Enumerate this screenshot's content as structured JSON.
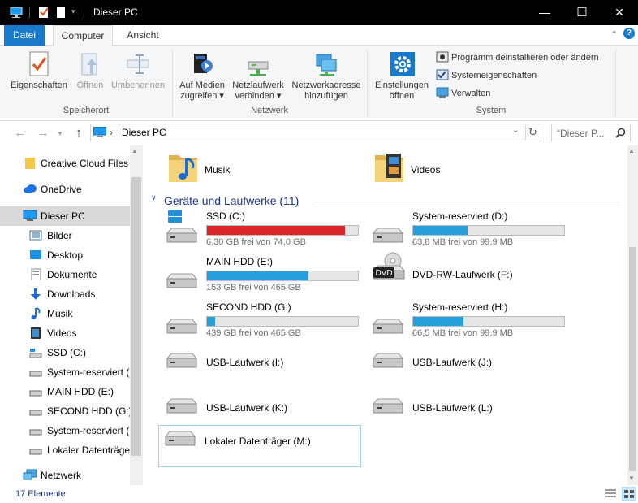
{
  "window": {
    "title": "Dieser PC",
    "controls": {
      "minimize": "—",
      "maximize": "☐",
      "close": "✕"
    }
  },
  "ribbon_tabs": [
    "Datei",
    "Computer",
    "Ansicht"
  ],
  "ribbon": {
    "groups": [
      {
        "label": "Speicherort",
        "buttons": [
          "Eigenschaften",
          "Öffnen",
          "Umbenennen"
        ]
      },
      {
        "label": "Netzwerk",
        "buttons": [
          {
            "line1": "Auf Medien",
            "line2": "zugreifen"
          },
          {
            "line1": "Netzlaufwerk",
            "line2": "verbinden"
          },
          {
            "line1": "Netzwerkadresse",
            "line2": "hinzufügen"
          }
        ]
      },
      {
        "label": "System",
        "buttons": [
          {
            "line1": "Einstellungen",
            "line2": "öffnen"
          }
        ],
        "small": [
          "Programm deinstallieren oder ändern",
          "Systemeigenschaften",
          "Verwalten"
        ]
      }
    ]
  },
  "address": {
    "path": "Dieser PC",
    "search_placeholder": "“Dieser P...",
    "separator": "›"
  },
  "nav": [
    {
      "label": "Creative Cloud Files",
      "icon": "folder-icon"
    },
    {
      "label": "OneDrive",
      "icon": "cloud-icon"
    },
    {
      "label": "Dieser PC",
      "icon": "computer-icon",
      "selected": true
    },
    {
      "label": "Bilder",
      "icon": "pictures-icon"
    },
    {
      "label": "Desktop",
      "icon": "desktop-icon"
    },
    {
      "label": "Dokumente",
      "icon": "documents-icon"
    },
    {
      "label": "Downloads",
      "icon": "download-icon"
    },
    {
      "label": "Musik",
      "icon": "music-icon"
    },
    {
      "label": "Videos",
      "icon": "video-icon"
    },
    {
      "label": "SSD (C:)",
      "icon": "drive-icon"
    },
    {
      "label": "System-reserviert (D",
      "icon": "drive-icon"
    },
    {
      "label": "MAIN HDD (E:)",
      "icon": "drive-icon"
    },
    {
      "label": "SECOND HDD (G:)",
      "icon": "drive-icon"
    },
    {
      "label": "System-reserviert (H",
      "icon": "drive-icon"
    },
    {
      "label": "Lokaler Datenträger",
      "icon": "drive-icon"
    },
    {
      "label": "Netzwerk",
      "icon": "network-icon"
    }
  ],
  "folders": [
    {
      "label": "Musik",
      "icon": "music-folder-icon"
    },
    {
      "label": "Videos",
      "icon": "video-folder-icon"
    }
  ],
  "section": {
    "title": "Geräte und Laufwerke (11)"
  },
  "drives": [
    {
      "name": "SSD (C:)",
      "free": "6,30 GB frei von 74,0 GB",
      "used_fraction": 0.915,
      "critical": true
    },
    {
      "name": "System-reserviert (D:)",
      "free": "63,8 MB frei von 99,9 MB",
      "used_fraction": 0.36
    },
    {
      "name": "MAIN HDD (E:)",
      "free": "153 GB frei von 465 GB",
      "used_fraction": 0.67
    },
    {
      "name": "DVD-RW-Laufwerk (F:)",
      "free": "",
      "used_fraction": null,
      "dvd_label": "DVD"
    },
    {
      "name": "SECOND HDD (G:)",
      "free": "439 GB frei von 465 GB",
      "used_fraction": 0.056
    },
    {
      "name": "System-reserviert (H:)",
      "free": "66,5 MB frei von 99,9 MB",
      "used_fraction": 0.334
    },
    {
      "name": "USB-Laufwerk (I:)",
      "free": "",
      "used_fraction": null
    },
    {
      "name": "USB-Laufwerk (J:)",
      "free": "",
      "used_fraction": null
    },
    {
      "name": "USB-Laufwerk (K:)",
      "free": "",
      "used_fraction": null
    },
    {
      "name": "USB-Laufwerk (L:)",
      "free": "",
      "used_fraction": null
    },
    {
      "name": "Lokaler Datenträger (M:)",
      "free": "",
      "used_fraction": null,
      "selected_outline": true
    }
  ],
  "status": {
    "count": "17 Elemente"
  },
  "colors": {
    "accent": "#1979ca",
    "bar_fill": "#26a0da",
    "bar_critical": "#da2626",
    "section": "#1e3287"
  }
}
